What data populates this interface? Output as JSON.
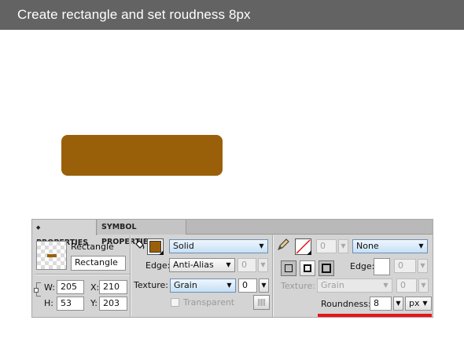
{
  "header": {
    "title": "Create rectangle and set roudness 8px"
  },
  "canvas": {
    "shape_color": "#9a6009"
  },
  "panel": {
    "tabs": [
      {
        "label": "PROPERTIES",
        "icon": "expand-diamond-icon"
      },
      {
        "label": "SYMBOL PROPERTIES"
      }
    ],
    "element_type": "Rectangle",
    "object_name": "Rectangle",
    "geometry": {
      "w_label": "W:",
      "w_value": "205",
      "x_label": "X:",
      "x_value": "210",
      "h_label": "H:",
      "h_value": "53",
      "y_label": "Y:",
      "y_value": "203"
    },
    "fill": {
      "icon": "paint-bucket-icon",
      "color": "#9a6009",
      "type": "Solid",
      "edge_label": "Edge:",
      "edge_value": "Anti-Alias",
      "edge_amount": "0",
      "texture_label": "Texture:",
      "texture_value": "Grain",
      "texture_amount": "0",
      "transparent_label": "Transparent"
    },
    "stroke": {
      "icon": "pencil-icon",
      "color_state": "none",
      "size": "0",
      "type": "None",
      "edge_label": "Edge:",
      "edge_amount": "0",
      "texture_label": "Texture:",
      "texture_value": "Grain",
      "texture_amount": "0",
      "roundness_label": "Roundness:",
      "roundness_value": "8",
      "roundness_unit": "px"
    },
    "highlight_color": "#e8141a"
  }
}
